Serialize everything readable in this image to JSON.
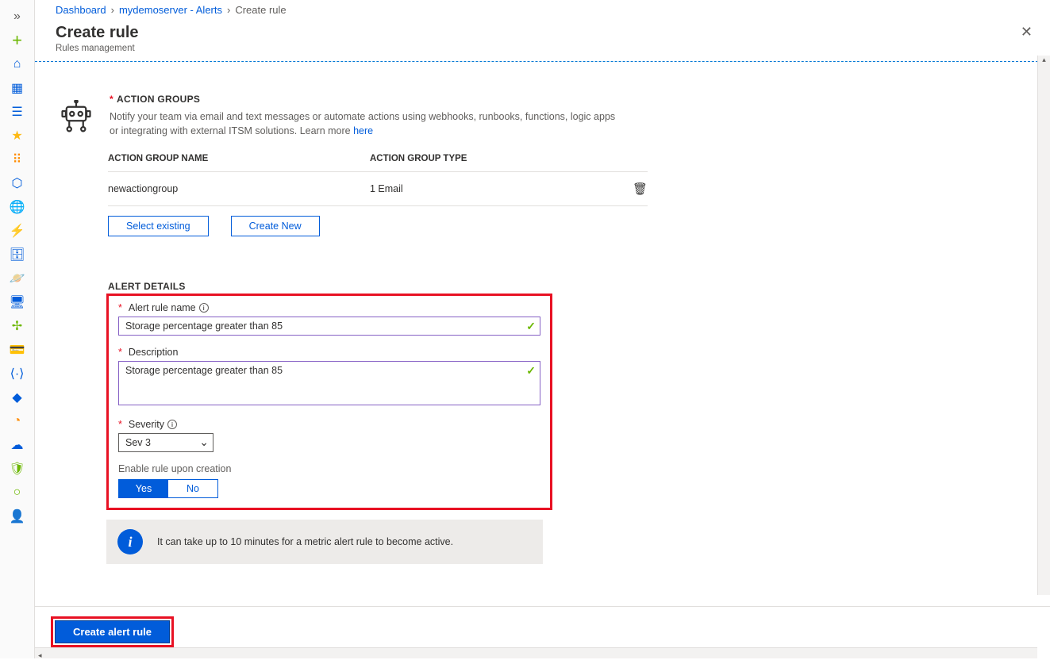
{
  "breadcrumb": {
    "items": [
      "Dashboard",
      "mydemoserver - Alerts",
      "Create rule"
    ]
  },
  "header": {
    "title": "Create rule",
    "subtitle": "Rules management"
  },
  "actionGroups": {
    "heading": "ACTION GROUPS",
    "description": "Notify your team via email and text messages or automate actions using webhooks, runbooks, functions, logic apps or integrating with external ITSM solutions. Learn more ",
    "learnMore": "here",
    "columns": {
      "name": "ACTION GROUP NAME",
      "type": "ACTION GROUP TYPE"
    },
    "rows": [
      {
        "name": "newactiongroup",
        "type": "1 Email"
      }
    ],
    "buttons": {
      "selectExisting": "Select existing",
      "createNew": "Create New"
    }
  },
  "alertDetails": {
    "heading": "ALERT DETAILS",
    "nameLabel": "Alert rule name",
    "nameValue": "Storage percentage greater than 85",
    "descLabel": "Description",
    "descValue": "Storage percentage greater than 85",
    "severityLabel": "Severity",
    "severityValue": "Sev 3",
    "enableLabel": "Enable rule upon creation",
    "yes": "Yes",
    "no": "No"
  },
  "infoBanner": "It can take up to 10 minutes for a metric alert rule to become active.",
  "footer": {
    "createButton": "Create alert rule"
  },
  "colors": {
    "blue": "#015cda",
    "red": "#e81123",
    "green": "#6bb700",
    "purple": "#8661c5"
  }
}
